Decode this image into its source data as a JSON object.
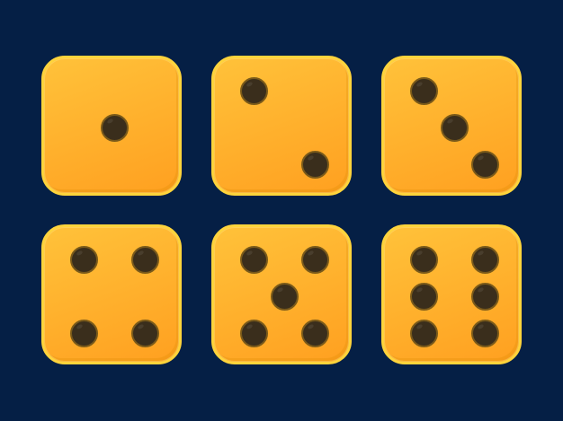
{
  "colors": {
    "background": "#051f45",
    "die_face_top": "#ffc23a",
    "die_face_bottom": "#ffa020",
    "die_border": "#ffd43b",
    "pip": "#3a2e1c"
  },
  "dice": [
    {
      "value": 1
    },
    {
      "value": 2
    },
    {
      "value": 3
    },
    {
      "value": 4
    },
    {
      "value": 5
    },
    {
      "value": 6
    }
  ]
}
